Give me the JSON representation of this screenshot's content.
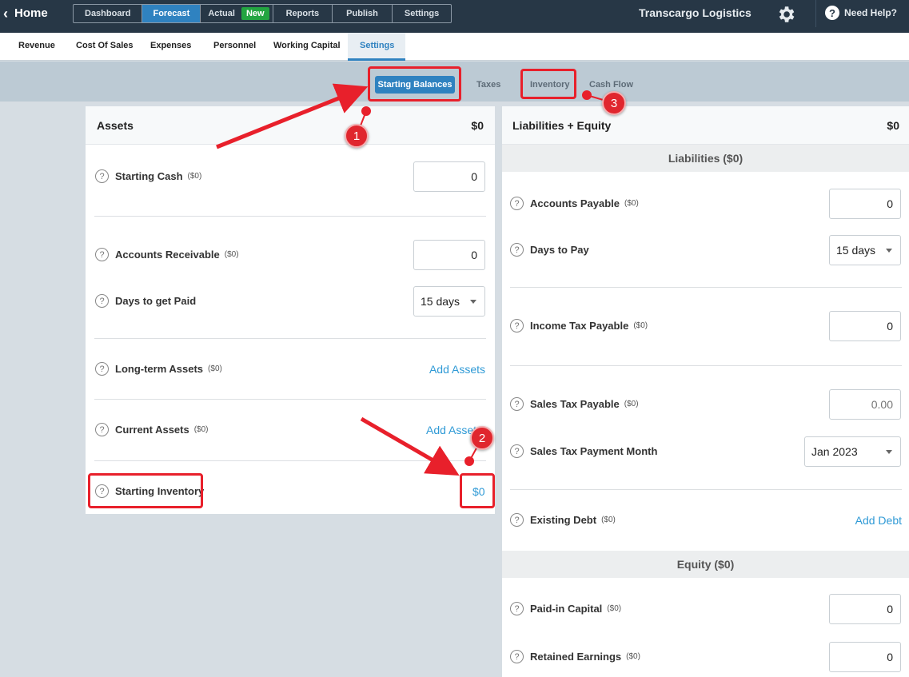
{
  "topbar": {
    "home_label": "Home",
    "nav": [
      {
        "label": "Dashboard"
      },
      {
        "label": "Forecast"
      },
      {
        "label": "Actual"
      },
      {
        "label": "Reports"
      },
      {
        "label": "Publish"
      },
      {
        "label": "Settings"
      }
    ],
    "new_badge": "New",
    "company": "Transcargo Logistics",
    "help_label": "Need Help?",
    "help_icon": "?"
  },
  "subtabs": [
    "Revenue",
    "Cost Of Sales",
    "Expenses",
    "Personnel",
    "Working Capital",
    "Settings"
  ],
  "settings_tabs": {
    "starting_balances": "Starting Balances",
    "taxes": "Taxes",
    "inventory": "Inventory",
    "cash_flow": "Cash Flow"
  },
  "assets": {
    "title": "Assets",
    "total": "$0",
    "starting_cash": {
      "label": "Starting Cash",
      "sub": "($0)",
      "value": "0"
    },
    "accounts_receivable": {
      "label": "Accounts Receivable",
      "sub": "($0)",
      "value": "0"
    },
    "days_to_get_paid": {
      "label": "Days to get Paid",
      "value": "15 days"
    },
    "long_term_assets": {
      "label": "Long-term Assets",
      "sub": "($0)",
      "link": "Add Assets"
    },
    "current_assets": {
      "label": "Current Assets",
      "sub": "($0)",
      "link": "Add Assets"
    },
    "starting_inventory": {
      "label": "Starting Inventory",
      "link": "$0"
    }
  },
  "liabilities_equity": {
    "title": "Liabilities + Equity",
    "total": "$0",
    "liabilities_band": "Liabilities  ($0)",
    "accounts_payable": {
      "label": "Accounts Payable",
      "sub": "($0)",
      "value": "0"
    },
    "days_to_pay": {
      "label": "Days to Pay",
      "value": "15 days"
    },
    "income_tax_payable": {
      "label": "Income Tax Payable",
      "sub": "($0)",
      "value": "0"
    },
    "sales_tax_payable": {
      "label": "Sales Tax Payable",
      "sub": "($0)",
      "placeholder": "0.00"
    },
    "sales_tax_payment_month": {
      "label": "Sales Tax Payment Month",
      "value": "Jan 2023"
    },
    "existing_debt": {
      "label": "Existing Debt",
      "sub": "($0)",
      "link": "Add Debt"
    },
    "equity_band": "Equity  ($0)",
    "paid_in_capital": {
      "label": "Paid-in Capital",
      "sub": "($0)",
      "value": "0"
    },
    "retained_earnings": {
      "label": "Retained Earnings",
      "sub": "($0)",
      "value": "0"
    }
  },
  "help_glyph": "?",
  "callouts": [
    "1",
    "2",
    "3"
  ],
  "colors": {
    "brand_dark": "#273746",
    "accent": "#2f82c0",
    "link": "#2f9ad6",
    "new_badge": "#23a541",
    "annotation": "#e8202b"
  }
}
